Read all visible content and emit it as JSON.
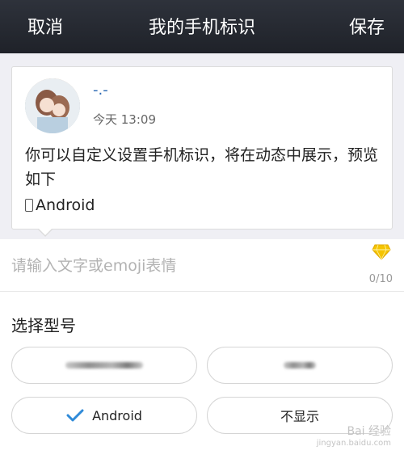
{
  "header": {
    "cancel_label": "取消",
    "title": "我的手机标识",
    "save_label": "保存"
  },
  "preview": {
    "username": "-.-",
    "timestamp": "今天 13:09",
    "text": "你可以自定义设置手机标识，将在动态中展示，预览如下",
    "device_label": "Android"
  },
  "input": {
    "placeholder": "请输入文字或emoji表情",
    "counter": "0/10",
    "icon": "gem-icon"
  },
  "model_section": {
    "title": "选择型号",
    "options": [
      {
        "label": "",
        "selected": false,
        "blurred": true
      },
      {
        "label": "",
        "selected": false,
        "blurred": true
      },
      {
        "label": "Android",
        "selected": true
      },
      {
        "label": "不显示",
        "selected": false
      }
    ]
  },
  "watermark": {
    "brand": "Bai 经验",
    "url": "jingyan.baidu.com"
  },
  "colors": {
    "header_bg": "#262a31",
    "accent_blue": "#2d6bb5",
    "check_blue": "#2f8ad8",
    "gem_yellow": "#f5c400"
  }
}
